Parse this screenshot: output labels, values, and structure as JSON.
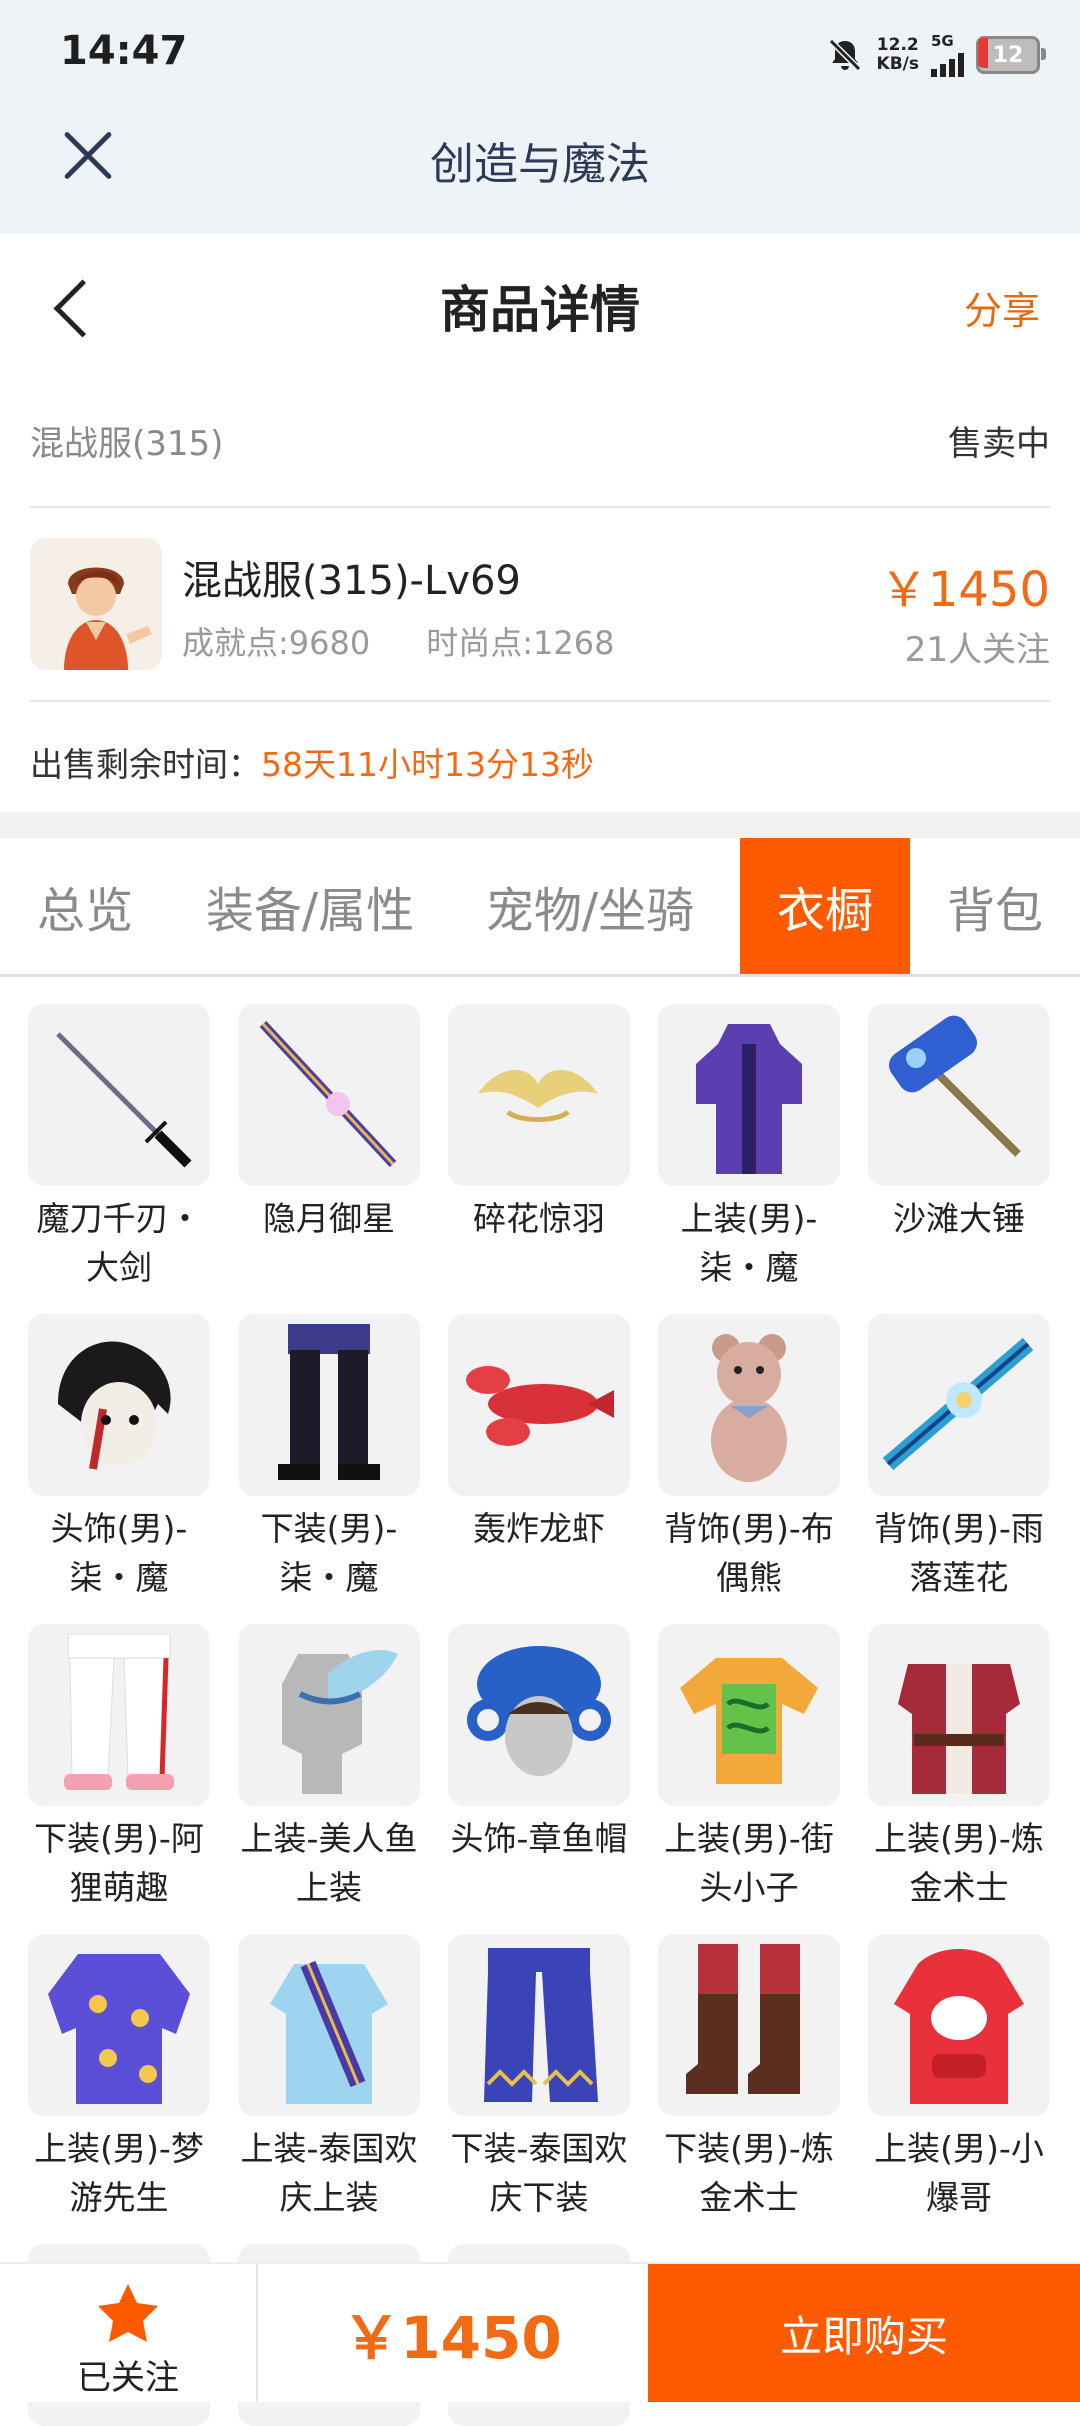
{
  "status_bar": {
    "time": "14:47",
    "speed_value": "12.2",
    "speed_unit": "KB/s",
    "signal_label": "5G",
    "battery": "12"
  },
  "app_header": {
    "title": "创造与魔法"
  },
  "page_header": {
    "title": "商品详情",
    "share": "分享"
  },
  "listing": {
    "server": "混战服(315)",
    "status": "售卖中",
    "title": "混战服(315)-Lv69",
    "achievement": "成就点:9680",
    "fashion": "时尚点:1268",
    "price": "￥1450",
    "followers": "21人关注",
    "timer_label": "出售剩余时间：",
    "timer_value": "58天11小时13分13秒"
  },
  "tabs": [
    {
      "label": "总览",
      "active": false
    },
    {
      "label": "装备/属性",
      "active": false
    },
    {
      "label": "宠物/坐骑",
      "active": false
    },
    {
      "label": "衣橱",
      "active": true
    },
    {
      "label": "背包",
      "active": false
    }
  ],
  "wardrobe": [
    {
      "label": "魔刀千刃・大剑",
      "icon": "katana-icon"
    },
    {
      "label": "隐月御星",
      "icon": "staff-icon"
    },
    {
      "label": "碎花惊羽",
      "icon": "golden-wings-icon"
    },
    {
      "label": "上装(男)-柒・魔",
      "icon": "purple-coat-icon"
    },
    {
      "label": "沙滩大锤",
      "icon": "hammer-icon"
    },
    {
      "label": "头饰(男)-柒・魔",
      "icon": "hair-mask-icon"
    },
    {
      "label": "下装(男)-柒・魔",
      "icon": "dark-pants-icon"
    },
    {
      "label": "轰炸龙虾",
      "icon": "lobster-icon"
    },
    {
      "label": "背饰(男)-布偶熊",
      "icon": "teddy-bear-icon"
    },
    {
      "label": "背饰(男)-雨落莲花",
      "icon": "lotus-umbrella-icon"
    },
    {
      "label": "下装(男)-阿狸萌趣",
      "icon": "white-pants-icon"
    },
    {
      "label": "上装-美人鱼上装",
      "icon": "mermaid-top-icon"
    },
    {
      "label": "头饰-章鱼帽",
      "icon": "octopus-hat-icon"
    },
    {
      "label": "上装(男)-街头小子",
      "icon": "street-shirt-icon"
    },
    {
      "label": "上装(男)-炼金术士",
      "icon": "alchemist-coat-icon"
    },
    {
      "label": "上装(男)-梦游先生",
      "icon": "pajama-top-icon"
    },
    {
      "label": "上装-泰国欢庆上装",
      "icon": "thai-top-icon"
    },
    {
      "label": "下装-泰国欢庆下装",
      "icon": "thai-pants-icon"
    },
    {
      "label": "下装(男)-炼金术士",
      "icon": "boots-icon"
    },
    {
      "label": "上装(男)-小爆哥",
      "icon": "red-hoodie-icon"
    }
  ],
  "bottom_bar": {
    "follow_label": "已关注",
    "price": "￥1450",
    "buy_label": "立即购买"
  },
  "colors": {
    "accent": "#ff5a00",
    "price": "#f26a12",
    "header_bg": "#eef3f7"
  }
}
